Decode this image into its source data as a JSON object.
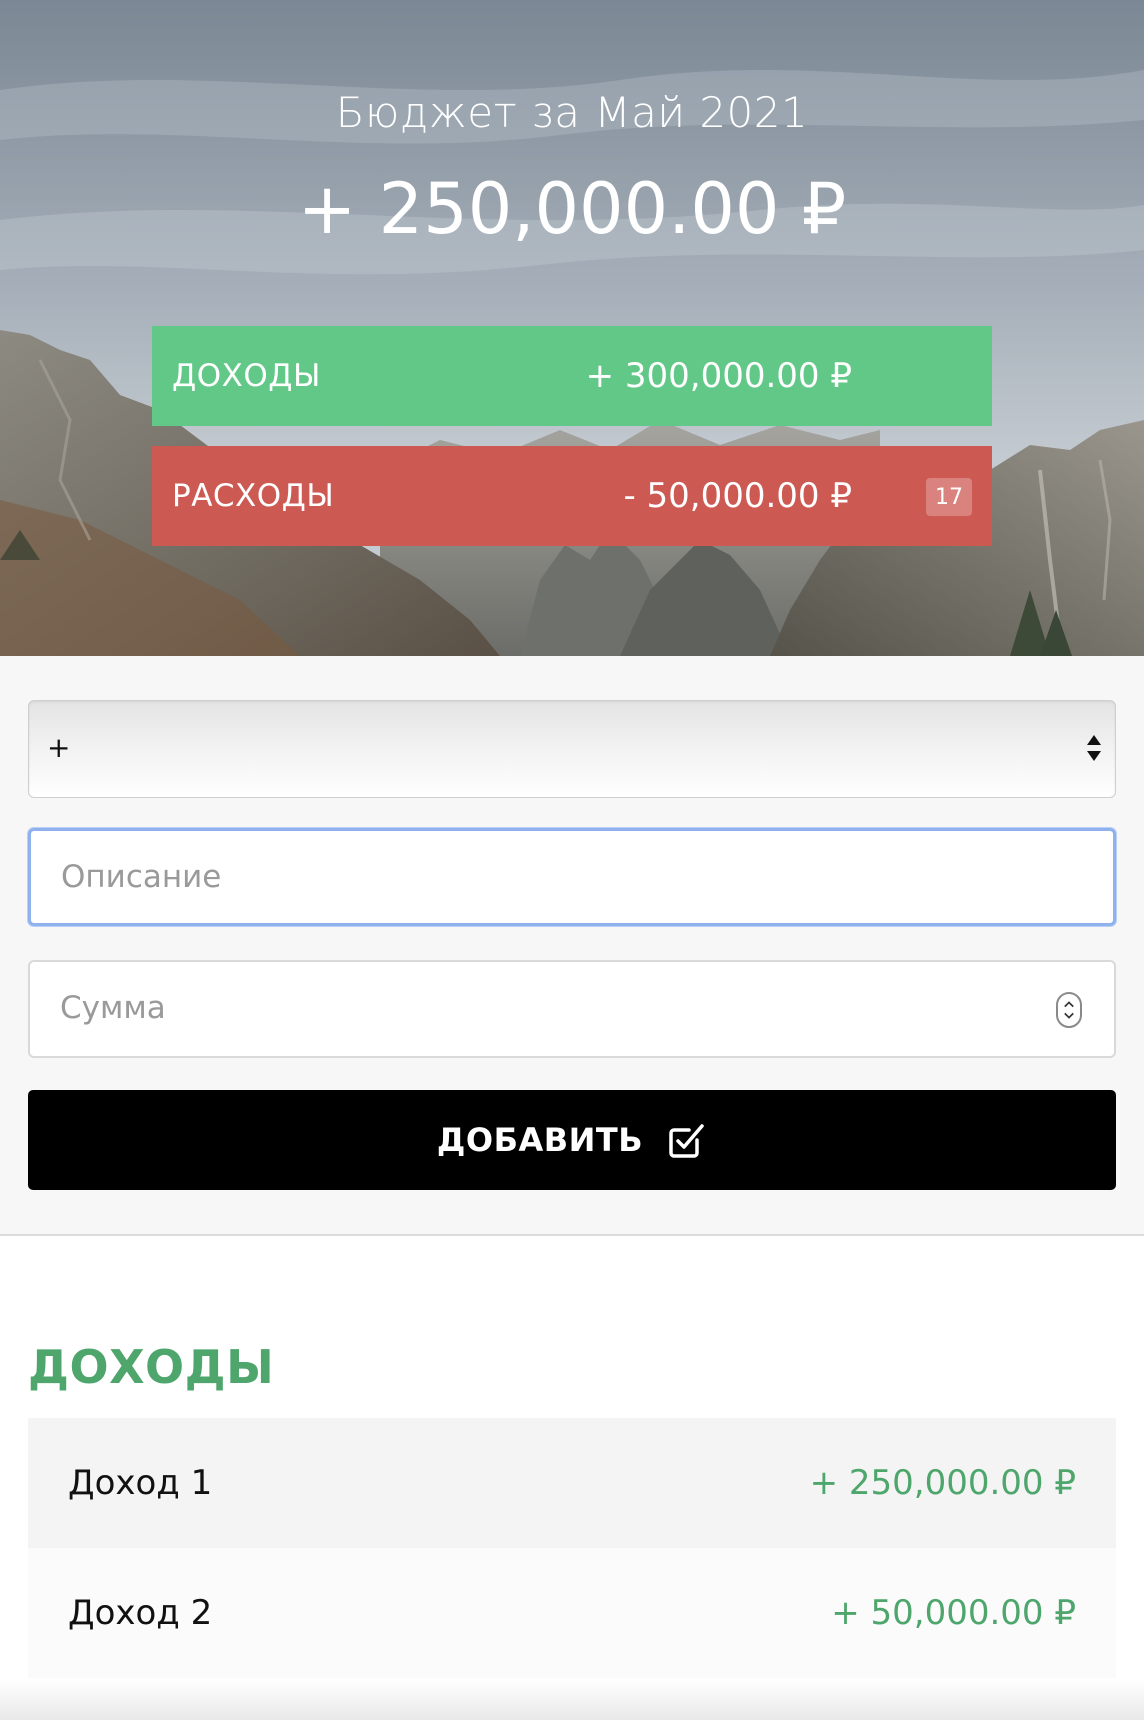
{
  "header": {
    "title": "Бюджет за Май 2021",
    "total": "+ 250,000.00 ₽"
  },
  "summary": {
    "income": {
      "label": "ДОХОДЫ",
      "value": "+ 300,000.00 ₽",
      "color": "#62c887"
    },
    "expense": {
      "label": "РАСХОДЫ",
      "value": "- 50,000.00 ₽",
      "badge": "17",
      "color": "#cd5953"
    }
  },
  "form": {
    "type_select": {
      "value": "+"
    },
    "description": {
      "placeholder": "Описание",
      "value": ""
    },
    "amount": {
      "placeholder": "Сумма",
      "value": ""
    },
    "add_button": {
      "label": "ДОБАВИТЬ",
      "icon": "checkbox-edit-icon"
    }
  },
  "income_list": {
    "title": "ДОХОДЫ",
    "accent": "#4ea66c",
    "items": [
      {
        "name": "Доход 1",
        "value": "+ 250,000.00 ₽"
      },
      {
        "name": "Доход 2",
        "value": "+ 50,000.00 ₽"
      }
    ]
  }
}
